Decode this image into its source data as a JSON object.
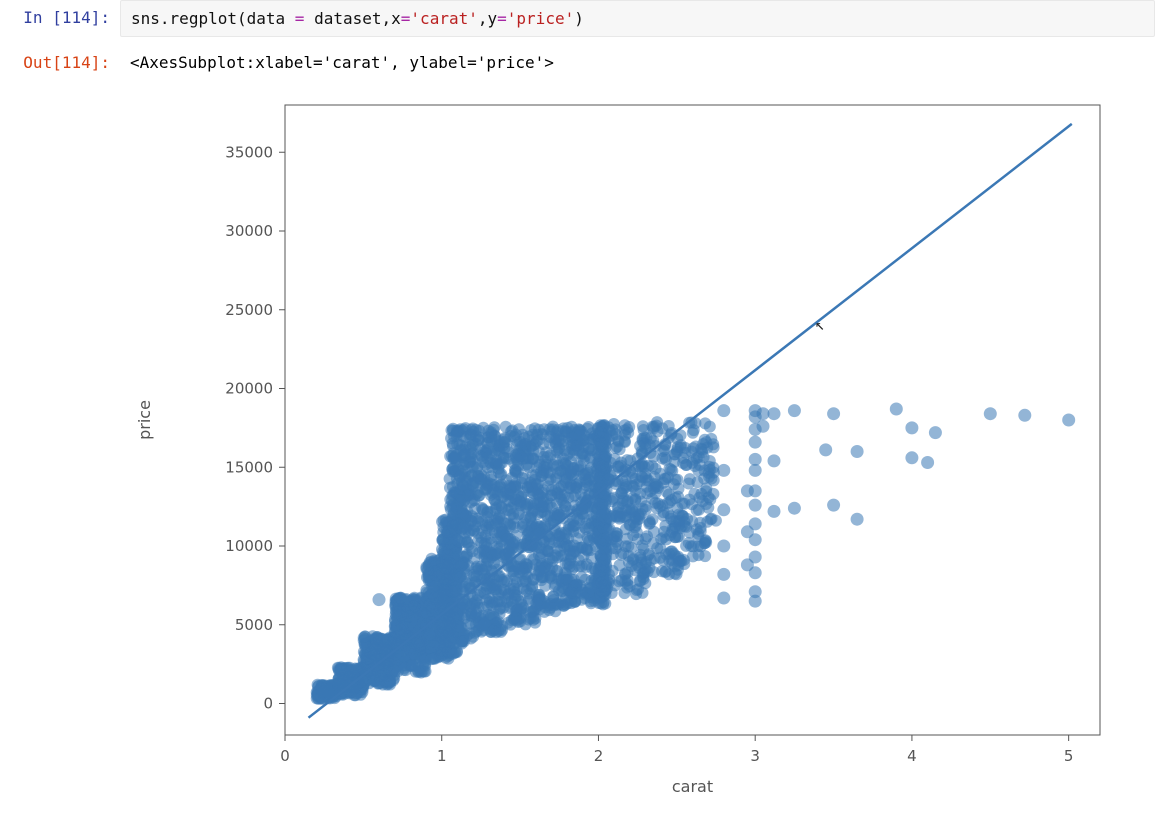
{
  "cells": {
    "in_prompt": "In [114]:",
    "out_prompt": "Out[114]:",
    "code_tokens": {
      "obj": "sns",
      "dot": ".",
      "fn": "regplot",
      "lp": "(",
      "k_data": "data",
      "eq": " = ",
      "v_data": "dataset",
      "comma": ",",
      "k_x": "x",
      "eq2": "=",
      "v_x": "'carat'",
      "k_y": "y",
      "v_y": "'price'",
      "rp": ")"
    },
    "out_text": "<AxesSubplot:xlabel='carat', ylabel='price'>"
  },
  "chart_data": {
    "type": "scatter",
    "title": "",
    "xlabel": "carat",
    "ylabel": "price",
    "xlim": [
      0,
      5.2
    ],
    "ylim": [
      -2000,
      38000
    ],
    "xticks": [
      0,
      1,
      2,
      3,
      4,
      5
    ],
    "yticks": [
      0,
      5000,
      10000,
      15000,
      20000,
      25000,
      30000,
      35000
    ],
    "regression": {
      "x": [
        0.15,
        5.02
      ],
      "y": [
        -900,
        36800
      ]
    },
    "series": [
      {
        "name": "diamonds",
        "bulk_cloud": {
          "comment": "Dense main cloud, represented as overlapping bands (x_start,x_end,y_min,y_max,n_points).",
          "bands": [
            [
              0.2,
              0.33,
              200,
              1300,
              120
            ],
            [
              0.33,
              0.5,
              350,
              2500,
              180
            ],
            [
              0.5,
              0.7,
              900,
              4600,
              260
            ],
            [
              0.7,
              0.9,
              1500,
              7200,
              280
            ],
            [
              0.9,
              1.05,
              2200,
              9800,
              260
            ],
            [
              1.0,
              1.1,
              2300,
              12500,
              220
            ],
            [
              1.05,
              1.2,
              2500,
              18800,
              300
            ],
            [
              1.2,
              1.4,
              3200,
              18800,
              300
            ],
            [
              1.4,
              1.6,
              3800,
              18800,
              280
            ],
            [
              1.6,
              1.8,
              4600,
              18800,
              260
            ],
            [
              1.8,
              2.0,
              5200,
              18800,
              260
            ],
            [
              2.0,
              2.05,
              5200,
              18800,
              220
            ],
            [
              2.05,
              2.3,
              5800,
              18800,
              200
            ],
            [
              2.3,
              2.55,
              7200,
              18800,
              160
            ],
            [
              2.55,
              2.75,
              8200,
              18800,
              90
            ]
          ]
        },
        "outliers": [
          [
            0.6,
            6600
          ],
          [
            0.99,
            6800
          ],
          [
            0.72,
            3700
          ],
          [
            2.8,
            18600
          ],
          [
            2.8,
            14800
          ],
          [
            2.8,
            12300
          ],
          [
            2.8,
            10000
          ],
          [
            2.8,
            8200
          ],
          [
            2.8,
            6700
          ],
          [
            2.95,
            13500
          ],
          [
            2.95,
            10900
          ],
          [
            2.95,
            8800
          ],
          [
            3.0,
            18600
          ],
          [
            3.0,
            18200
          ],
          [
            3.0,
            17400
          ],
          [
            3.0,
            16600
          ],
          [
            3.0,
            15500
          ],
          [
            3.0,
            14800
          ],
          [
            3.0,
            13500
          ],
          [
            3.0,
            12600
          ],
          [
            3.0,
            11400
          ],
          [
            3.0,
            10400
          ],
          [
            3.0,
            9300
          ],
          [
            3.0,
            8300
          ],
          [
            3.0,
            7100
          ],
          [
            3.0,
            6500
          ],
          [
            3.05,
            18400
          ],
          [
            3.05,
            17600
          ],
          [
            3.12,
            18400
          ],
          [
            3.12,
            15400
          ],
          [
            3.12,
            12200
          ],
          [
            3.25,
            18600
          ],
          [
            3.25,
            12400
          ],
          [
            3.45,
            16100
          ],
          [
            3.5,
            18400
          ],
          [
            3.5,
            12600
          ],
          [
            3.65,
            16000
          ],
          [
            3.65,
            11700
          ],
          [
            3.9,
            18700
          ],
          [
            4.0,
            17500
          ],
          [
            4.0,
            15600
          ],
          [
            4.1,
            15300
          ],
          [
            4.15,
            17200
          ],
          [
            4.5,
            18400
          ],
          [
            4.72,
            18300
          ],
          [
            5.0,
            18000
          ]
        ]
      }
    ]
  },
  "colors": {
    "point": "#3b78b5",
    "line": "#3b78b5",
    "axis": "#555555"
  }
}
